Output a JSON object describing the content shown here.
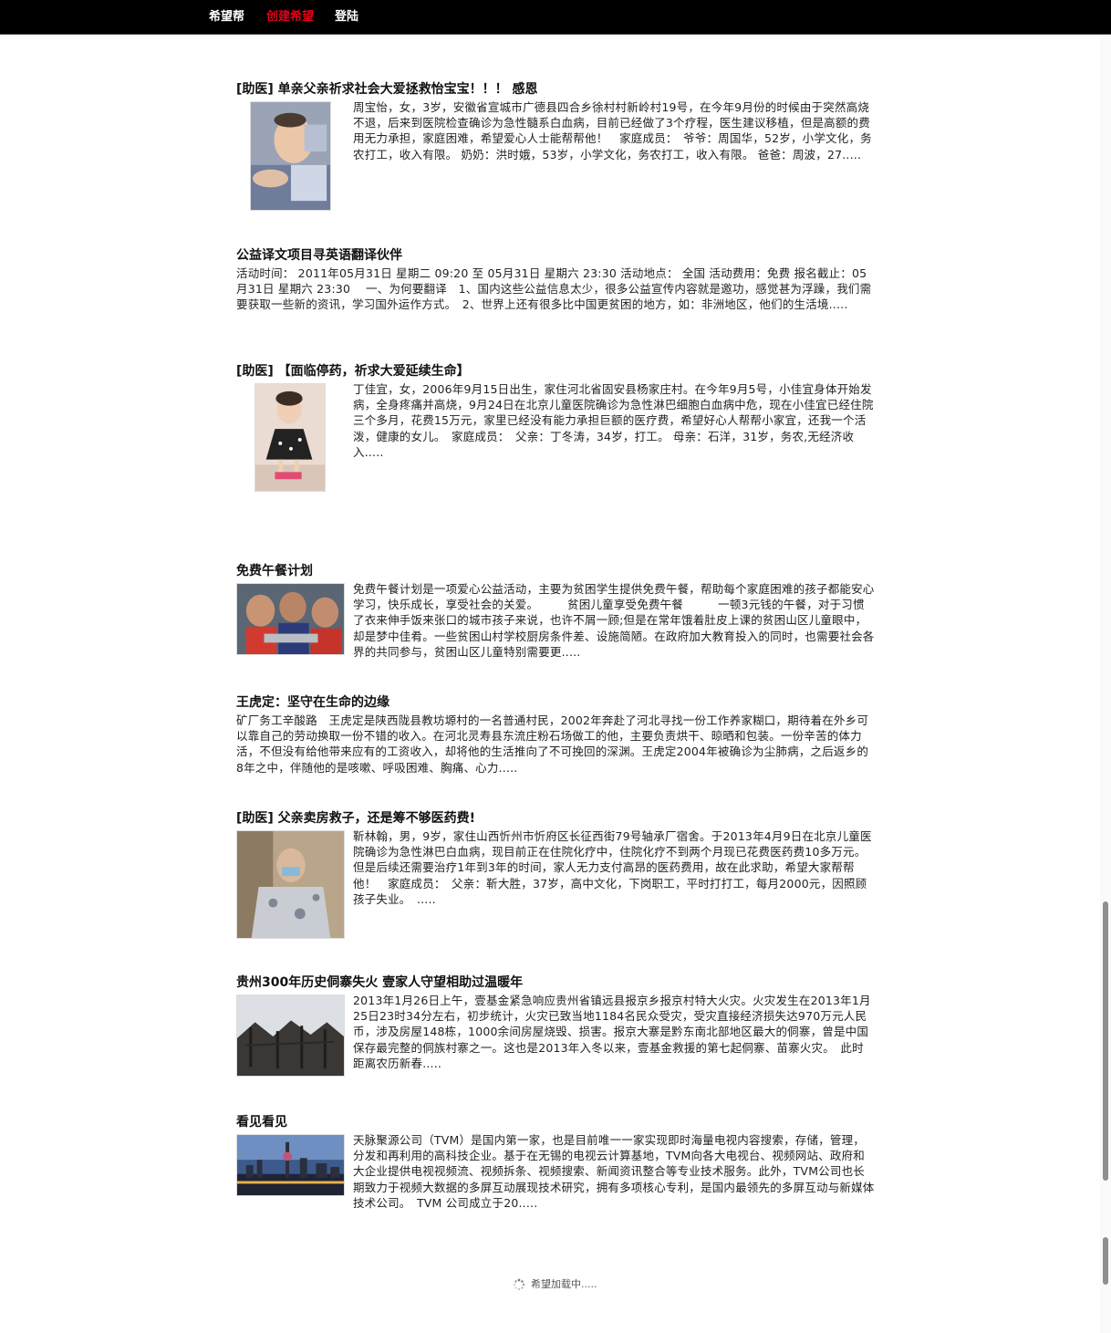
{
  "nav": {
    "brand": "希望帮",
    "create": "创建希望",
    "login": "登陆"
  },
  "posts": [
    {
      "title": "[助医] 单亲父亲祈求社会大爱拯救怡宝宝！！！ 感恩",
      "excerpt": "周宝怡，女，3岁，安徽省宣城市广德县四合乡徐村村新岭村19号，在今年9月份的时候由于突然高烧不退，后来到医院检查确诊为急性髓系白血病，目前已经做了3个疗程，医生建议移植，但是高额的费用无力承担，家庭困难，希望爱心人士能帮帮他！　家庭成员：　爷爷：周国华，52岁，小学文化，务农打工，收入有限。 奶奶：洪时娥，53岁，小学文化，务农打工，收入有限。 爸爸：周波，27.....",
      "image": "sick-baby-photo"
    },
    {
      "title": "公益译文项目寻英语翻译伙伴",
      "excerpt": "活动时间： 2011年05月31日 星期二 09:20 至 05月31日 星期六 23:30 活动地点： 全国 活动费用：免费 报名截止：05月31日 星期六 23:30　 一、为何要翻译　1、国内这些公益信息太少，很多公益宣传内容就是邀功，感觉甚为浮躁，我们需要获取一些新的资讯，学习国外运作方式。　2、世界上还有很多比中国更贫困的地方，如：非洲地区，他们的生活境.....",
      "image": ""
    },
    {
      "title": "[助医] 【面临停药，祈求大爱延续生命】",
      "excerpt": "丁佳宜，女，2006年9月15日出生，家住河北省固安县杨家庄村。在今年9月5号，小佳宜身体开始发病，全身疼痛并高烧，9月24日在北京儿童医院确诊为急性淋巴细胞白血病中危，现在小佳宜已经住院三个多月，花费15万元，家里已经没有能力承担巨额的医疗费，希望好心人帮帮小家宜，还我一个活泼，健康的女儿。　家庭成员：　父亲：丁冬涛，34岁，打工。 母亲：石洋，31岁，务农,无经济收入.....",
      "image": "girl-in-dress-photo"
    },
    {
      "title": "免费午餐计划",
      "excerpt": "免费午餐计划是一项爱心公益活动，主要为贫困学生提供免费午餐，帮助每个家庭困难的孩子都能安心学习，快乐成长，享受社会的关爱。　　　贫困儿童享受免费午餐　　　一顿3元钱的午餐，对于习惯了衣来伸手饭来张口的城市孩子来说，也许不屑一顾;但是在常年饿着肚皮上课的贫困山区儿童眼中，却是梦中佳肴。一些贫困山村学校厨房条件差、设施简陋。在政府加大教育投入的同时，也需要社会各界的共同参与，贫困山区儿童特别需要更.....",
      "image": "children-eating-photo"
    },
    {
      "title": "王虎定：坚守在生命的边缘",
      "excerpt": "矿厂务工辛酸路　王虎定是陕西陇县教坊塬村的一名普通村民，2002年奔赴了河北寻找一份工作养家糊口，期待着在外乡可以靠自己的劳动换取一份不错的收入。在河北灵寿县东流庄粉石场做工的他，主要负责烘干、晾晒和包装。一份辛苦的体力活，不但没有给他带来应有的工资收入，却将他的生活推向了不可挽回的深渊。王虎定2004年被确诊为尘肺病，之后返乡的8年之中，伴随他的是咳嗽、呼吸困难、胸痛、心力.....",
      "image": ""
    },
    {
      "title": "[助医] 父亲卖房救子，还是筹不够医药费!",
      "excerpt": "靳林翰，男，9岁，家住山西忻州市忻府区长征西街79号轴承厂宿舍。于2013年4月9日在北京儿童医院确诊为急性淋巴白血病，现目前正在住院化疗中，住院化疗不到两个月现已花费医药费10多万元。但是后续还需要治疗1年到3年的时间，家人无力支付高昂的医药费用，故在此求助，希望大家帮帮他！　家庭成员：　父亲：靳大胜，37岁，高中文化，下岗职工，平时打打工，每月2000元，因照顾孩子失业。　.....",
      "image": "boy-with-mask-photo"
    },
    {
      "title": "贵州300年历史侗寨失火 壹家人守望相助过温暖年",
      "excerpt": "2013年1月26日上午，壹基金紧急响应贵州省镇远县报京乡报京村特大火灾。火灾发生在2013年1月25日23时34分左右，初步统计，火灾已致当地1184名民众受灾，受灾直接经济损失达970万元人民币，涉及房屋148栋，1000余间房屋烧毁、损害。报京大寨是黔东南北部地区最大的侗寨，曾是中国保存最完整的侗族村寨之一。这也是2013年入冬以来，壹基金救援的第七起侗寨、苗寨火灾。　此时距离农历新春.....",
      "image": "burned-village-photo"
    },
    {
      "title": "看见看见",
      "excerpt": "天脉聚源公司（TVM）是国内第一家，也是目前唯一一家实现即时海量电视内容搜索，存储，管理，分发和再利用的高科技企业。基于在无锡的电视云计算基地，TVM向各大电视台、视频网站、政府和大企业提供电视视频流、视频拆条、视频搜索、新闻资讯整合等专业技术服务。此外，TVM公司也长期致力于视频大数据的多屏互动展现技术研究，拥有多项核心专利，是国内最领先的多屏互动与新媒体技术公司。　TVM 公司成立于20.....",
      "image": "city-skyline-photo"
    }
  ],
  "loading_text": "希望加载中....."
}
